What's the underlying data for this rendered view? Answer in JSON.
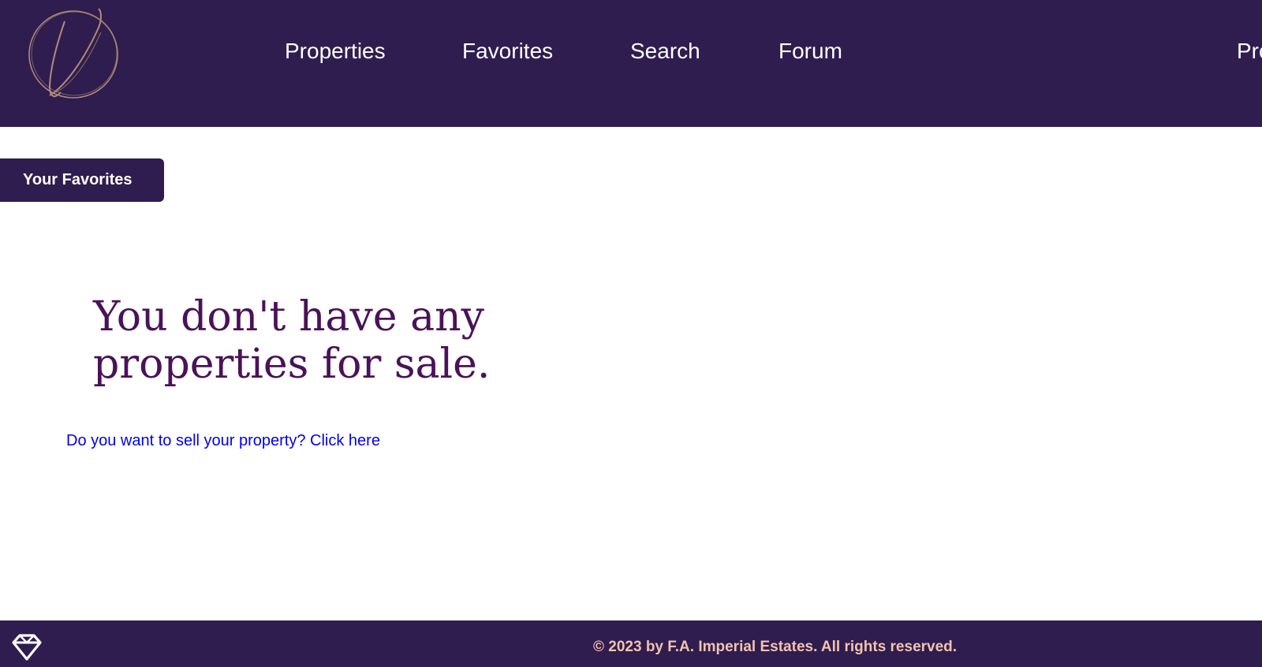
{
  "header": {
    "nav": {
      "properties": "Properties",
      "favorites": "Favorites",
      "search": "Search",
      "forum": "Forum",
      "profile": "Pro"
    },
    "logo_icon": "script-letter-logo-icon"
  },
  "main": {
    "favorites_button_label": "Your Favorites",
    "empty_heading": "You don't have any properties for sale.",
    "sell_link": "Do you want to sell your property? Click here"
  },
  "footer": {
    "icon": "diamond-icon",
    "copyright": "© 2023 by F.A. Imperial Estates. All rights reserved."
  },
  "colors": {
    "brand_purple": "#2f1d4f",
    "heading_purple": "#4a1258",
    "link_blue": "#0000ee",
    "footer_text": "#f2c2ae",
    "logo_gold": "#b08a7a"
  }
}
